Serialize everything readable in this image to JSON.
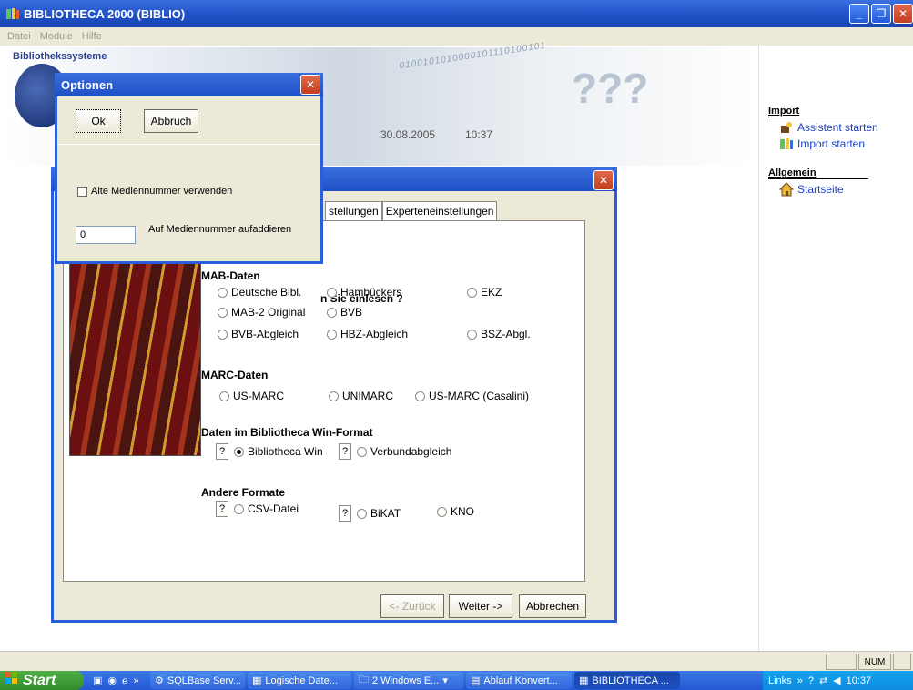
{
  "app": {
    "title": "BIBLIOTHECA 2000 (BIBLIO)",
    "menu": [
      "Datei",
      "Module",
      "Hilfe"
    ]
  },
  "banner": {
    "logo_text": "Bibliothekssysteme",
    "digits": "0100101010000101110100101",
    "date": "30.08.2005",
    "time": "10:37"
  },
  "right_panel": {
    "import_heading": "Import",
    "assistant": "Assistent starten",
    "import_start": "Import starten",
    "general_heading": "Allgemein",
    "startpage": "Startseite"
  },
  "wizard": {
    "tabs": [
      "stellungen",
      "Experteneinstellungen"
    ],
    "question": "n Sie einlesen ?",
    "groups": {
      "mab": {
        "label": "MAB-Daten",
        "options": [
          "Deutsche Bibl.",
          "Hambückers",
          "EKZ",
          "MAB-2 Original",
          "BVB",
          "BVB-Abgleich",
          "HBZ-Abgleich",
          "BSZ-Abgl."
        ]
      },
      "marc": {
        "label": "MARC-Daten",
        "options": [
          "US-MARC",
          "UNIMARC",
          "US-MARC (Casalini)"
        ]
      },
      "win": {
        "label": "Daten im Bibliotheca Win-Format",
        "options": [
          "Bibliotheca Win",
          "Verbundabgleich"
        ],
        "selected": "Bibliotheca Win"
      },
      "other": {
        "label": "Andere Formate",
        "options": [
          "CSV-Datei",
          "BiKAT",
          "KNO"
        ]
      }
    },
    "help": "?",
    "buttons": {
      "back": "<- Zurück",
      "next": "Weiter ->",
      "cancel": "Abbrechen"
    }
  },
  "options": {
    "title": "Optionen",
    "ok": "Ok",
    "cancel": "Abbruch",
    "old_number": "Alte Mediennummer verwenden",
    "add_value": "0",
    "add_label": "Auf Mediennummer aufaddieren"
  },
  "statusbar": {
    "num": "NUM"
  },
  "taskbar": {
    "start": "Start",
    "tasks": [
      "SQLBase Serv...",
      "Logische Date...",
      "2 Windows E...",
      "Ablauf Konvert...",
      "BIBLIOTHECA ..."
    ],
    "links": "Links",
    "clock": "10:37"
  }
}
